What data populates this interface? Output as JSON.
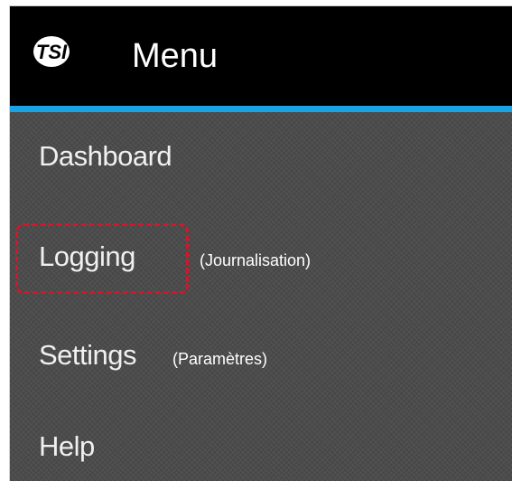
{
  "header": {
    "logo_text": "TSI",
    "title": "Menu"
  },
  "colors": {
    "header_bg": "#000000",
    "accent": "#1aa3e3",
    "menu_bg": "#4a4a4a",
    "highlight": "#d3162a"
  },
  "menu": {
    "items": [
      {
        "label": "Dashboard",
        "note": ""
      },
      {
        "label": "Logging",
        "note": "(Journalisation)",
        "highlighted": true
      },
      {
        "label": "Settings",
        "note": "(Paramètres)"
      },
      {
        "label": "Help",
        "note": ""
      }
    ]
  }
}
